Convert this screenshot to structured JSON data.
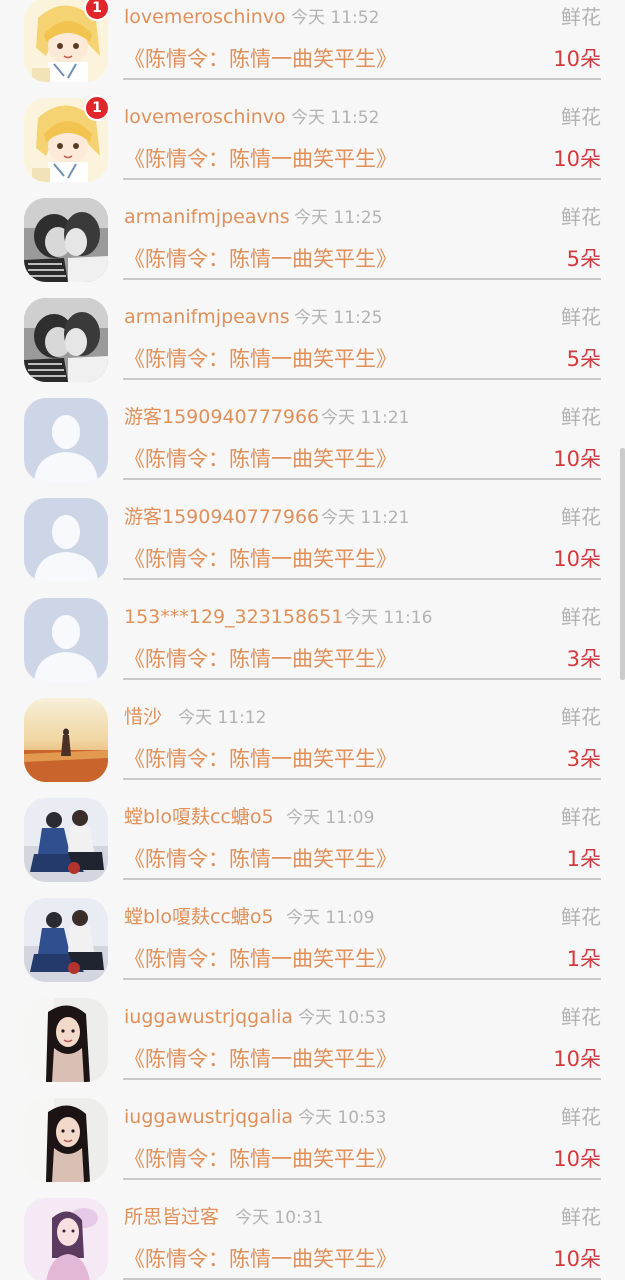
{
  "gift_label": "鲜花",
  "book_title": "《陈情令：陈情一曲笑平生》",
  "rows": [
    {
      "name": "lovemeroschinvo",
      "time": "今天 11:52",
      "amount": "10朵",
      "avatar": "anime-avatar",
      "badge": "1"
    },
    {
      "name": "lovemeroschinvo",
      "time": "今天 11:52",
      "amount": "10朵",
      "avatar": "anime-avatar",
      "badge": "1"
    },
    {
      "name": "armanifmjpeavns",
      "time": "今天 11:25",
      "amount": "5朵",
      "avatar": "couple-bw-avatar",
      "badge": ""
    },
    {
      "name": "armanifmjpeavns",
      "time": "今天 11:25",
      "amount": "5朵",
      "avatar": "couple-bw-avatar",
      "badge": ""
    },
    {
      "name": "游客1590940777966",
      "time": "今天 11:21",
      "amount": "10朵",
      "avatar": "default-person-avatar",
      "badge": ""
    },
    {
      "name": "游客1590940777966",
      "time": "今天 11:21",
      "amount": "10朵",
      "avatar": "default-person-avatar",
      "badge": ""
    },
    {
      "name": "153***129_323158651",
      "time": "今天 11:16",
      "amount": "3朵",
      "avatar": "default-person-avatar",
      "badge": ""
    },
    {
      "name": "惜沙",
      "time": "今天 11:12",
      "amount": "3朵",
      "avatar": "sunset-field-avatar",
      "badge": ""
    },
    {
      "name": "螳blo嗄麸cc螗o5",
      "time": "今天 11:09",
      "amount": "1朵",
      "avatar": "sitting-couple-avatar",
      "badge": ""
    },
    {
      "name": "螳blo嗄麸cc螗o5",
      "time": "今天 11:09",
      "amount": "1朵",
      "avatar": "sitting-couple-avatar",
      "badge": ""
    },
    {
      "name": "iuggawustrjqgalia",
      "time": "今天 10:53",
      "amount": "10朵",
      "avatar": "girl-portrait-avatar",
      "badge": ""
    },
    {
      "name": "iuggawustrjqgalia",
      "time": "今天 10:53",
      "amount": "10朵",
      "avatar": "girl-portrait-avatar",
      "badge": ""
    },
    {
      "name": "所思皆过客",
      "time": "今天 10:31",
      "amount": "10朵",
      "avatar": "pink-girl-avatar",
      "badge": ""
    }
  ],
  "colors": {
    "name": "#e0905a",
    "time": "#b3b3b3",
    "amount": "#d53a3f",
    "badge": "#e0262b",
    "background": "#f8f7f8"
  }
}
